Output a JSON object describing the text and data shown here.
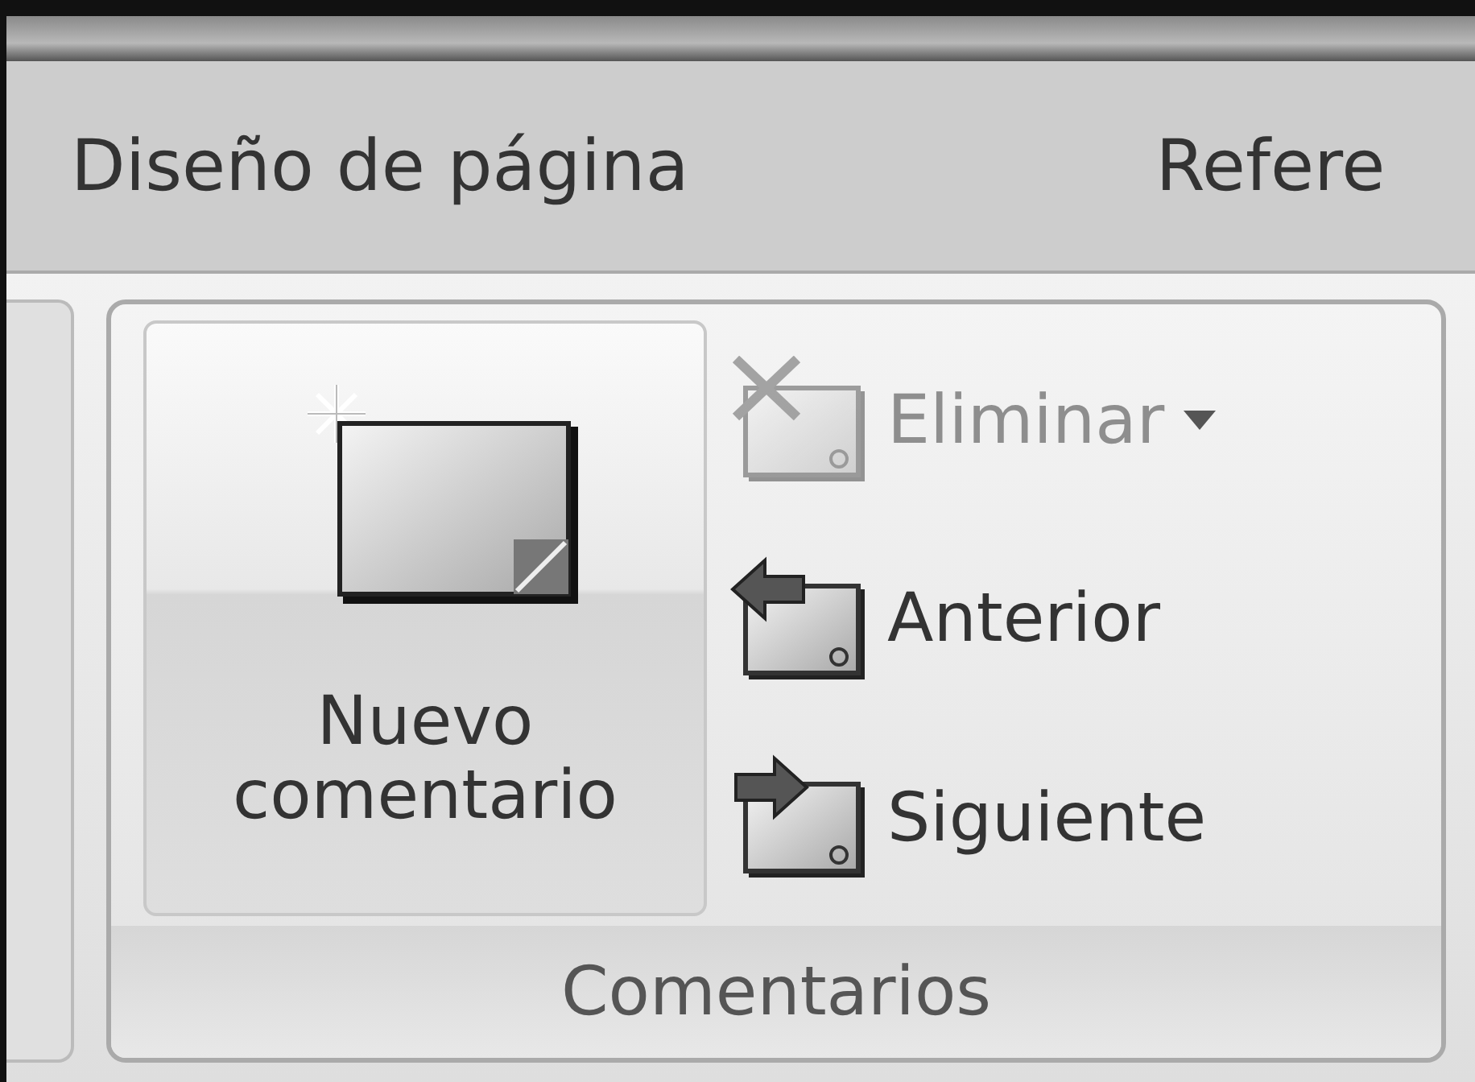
{
  "tabs": [
    {
      "label": "Diseño de página"
    },
    {
      "label": "Refere"
    }
  ],
  "group": {
    "title": "Comentarios",
    "large_button": {
      "label": "Nuevo comentario"
    },
    "buttons": [
      {
        "kind": "delete",
        "label": "Eliminar",
        "disabled": true,
        "has_menu": true
      },
      {
        "kind": "previous",
        "label": "Anterior",
        "disabled": false,
        "has_menu": false
      },
      {
        "kind": "next",
        "label": "Siguiente",
        "disabled": false,
        "has_menu": false
      }
    ]
  }
}
